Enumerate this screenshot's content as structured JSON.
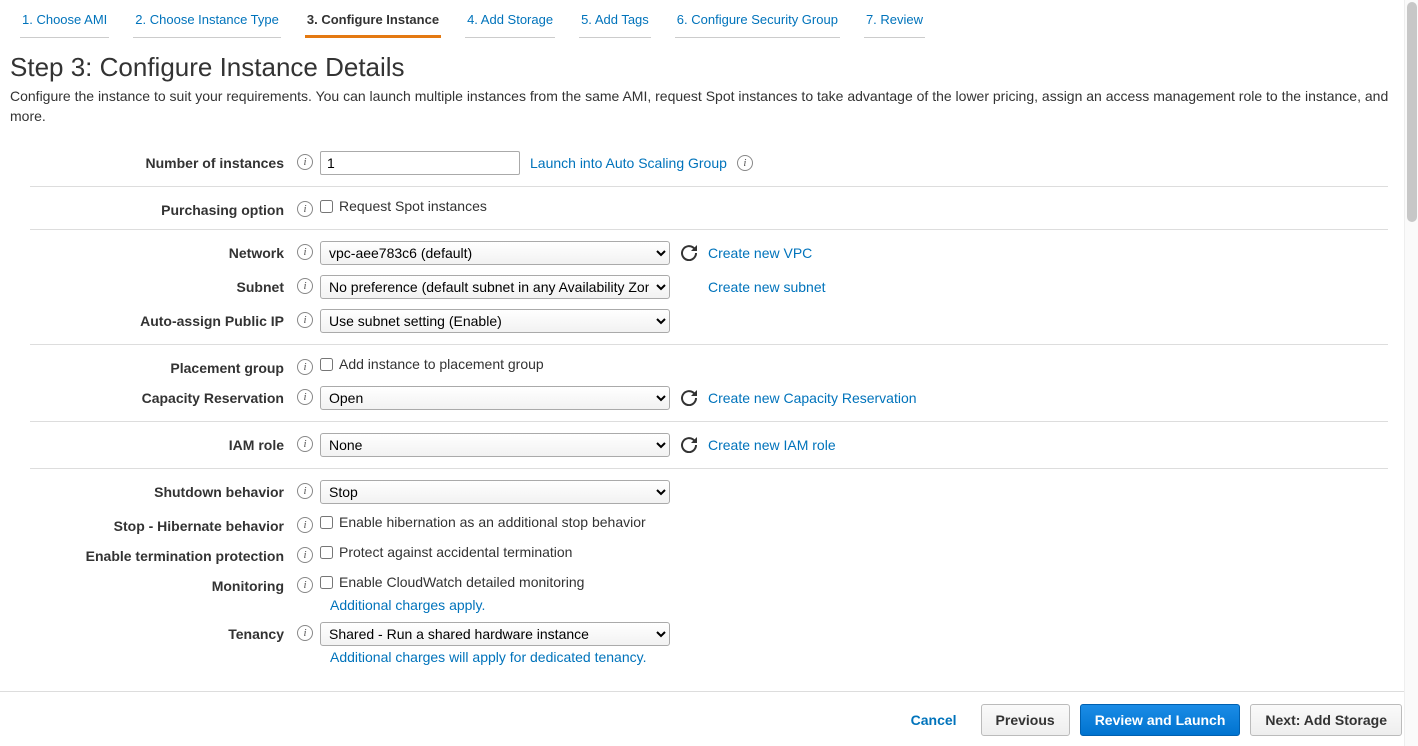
{
  "wizard": {
    "tabs": [
      "1. Choose AMI",
      "2. Choose Instance Type",
      "3. Configure Instance",
      "4. Add Storage",
      "5. Add Tags",
      "6. Configure Security Group",
      "7. Review"
    ],
    "active_index": 2
  },
  "heading": {
    "title": "Step 3: Configure Instance Details",
    "description": "Configure the instance to suit your requirements. You can launch multiple instances from the same AMI, request Spot instances to take advantage of the lower pricing, assign an access management role to the instance, and more."
  },
  "fields": {
    "num_instances": {
      "label": "Number of instances",
      "value": "1",
      "asg_link": "Launch into Auto Scaling Group"
    },
    "purchasing": {
      "label": "Purchasing option",
      "checkbox_label": "Request Spot instances",
      "checked": false
    },
    "network": {
      "label": "Network",
      "value": "vpc-aee783c6 (default)",
      "link": "Create new VPC"
    },
    "subnet": {
      "label": "Subnet",
      "value": "No preference (default subnet in any Availability Zone)",
      "link": "Create new subnet"
    },
    "public_ip": {
      "label": "Auto-assign Public IP",
      "value": "Use subnet setting (Enable)"
    },
    "placement_group": {
      "label": "Placement group",
      "checkbox_label": "Add instance to placement group",
      "checked": false
    },
    "capacity_reservation": {
      "label": "Capacity Reservation",
      "value": "Open",
      "link": "Create new Capacity Reservation"
    },
    "iam_role": {
      "label": "IAM role",
      "value": "None",
      "link": "Create new IAM role"
    },
    "shutdown": {
      "label": "Shutdown behavior",
      "value": "Stop"
    },
    "hibernate": {
      "label": "Stop - Hibernate behavior",
      "checkbox_label": "Enable hibernation as an additional stop behavior",
      "checked": false
    },
    "termination_protection": {
      "label": "Enable termination protection",
      "checkbox_label": "Protect against accidental termination",
      "checked": false
    },
    "monitoring": {
      "label": "Monitoring",
      "checkbox_label": "Enable CloudWatch detailed monitoring",
      "note": "Additional charges apply.",
      "checked": false
    },
    "tenancy": {
      "label": "Tenancy",
      "value": "Shared - Run a shared hardware instance",
      "note": "Additional charges will apply for dedicated tenancy."
    }
  },
  "footer": {
    "cancel": "Cancel",
    "previous": "Previous",
    "review": "Review and Launch",
    "next": "Next: Add Storage"
  }
}
